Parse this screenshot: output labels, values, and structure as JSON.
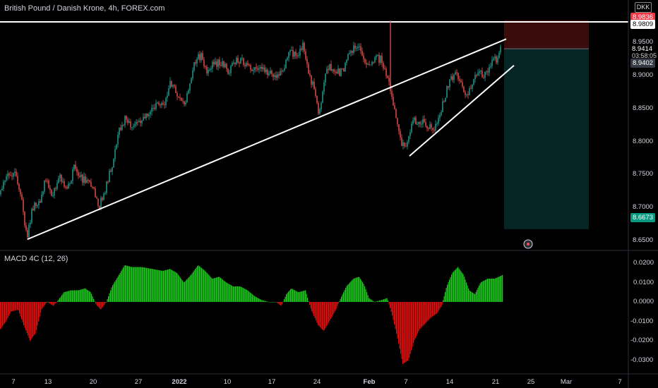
{
  "header": {
    "symbol_title": "British Pound / Danish Krone, 4h, FOREX.com",
    "currency_badge": "DKK"
  },
  "indicator": {
    "title": "MACD 4C (12, 26)"
  },
  "price_tags": {
    "stop_price": "8.9836",
    "level_price": "8.9809",
    "last_price": "8.9414",
    "countdown": "03:58:05",
    "entry_price": "8.9402",
    "target_price": "8.6673"
  },
  "colors": {
    "background": "#000000",
    "up_candle": "#26a69a",
    "down_candle": "#ef5350",
    "macd_positive": "#1ec81e",
    "macd_negative": "#e01010",
    "stop_zone": "#3a0d0d",
    "target_zone": "#062626",
    "stop_tag": "#f23645",
    "target_tag": "#089981",
    "trendline": "#ffffff"
  },
  "chart_data": [
    {
      "type": "candlestick",
      "title": "British Pound / Danish Krone, 4h, FOREX.com",
      "y_ticks": [
        "8.9500",
        "8.9000",
        "8.8500",
        "8.8000",
        "8.7500",
        "8.7000",
        "8.6500"
      ],
      "x_ticks": [
        "7",
        "13",
        "20",
        "27",
        "2022",
        "10",
        "17",
        "24",
        "Feb",
        "7",
        "14",
        "21",
        "25",
        "Mar",
        "7"
      ],
      "x_ticks_bold": [
        "2022",
        "Feb"
      ],
      "ylim": [
        8.635,
        8.985
      ],
      "price_path": [
        [
          0,
          8.72
        ],
        [
          10,
          8.75
        ],
        [
          22,
          8.75
        ],
        [
          30,
          8.72
        ],
        [
          38,
          8.652
        ],
        [
          46,
          8.7
        ],
        [
          56,
          8.705
        ],
        [
          64,
          8.74
        ],
        [
          75,
          8.72
        ],
        [
          85,
          8.748
        ],
        [
          95,
          8.725
        ],
        [
          105,
          8.76
        ],
        [
          112,
          8.745
        ],
        [
          125,
          8.74
        ],
        [
          133,
          8.73
        ],
        [
          140,
          8.7
        ],
        [
          150,
          8.73
        ],
        [
          160,
          8.77
        ],
        [
          170,
          8.82
        ],
        [
          178,
          8.835
        ],
        [
          188,
          8.82
        ],
        [
          200,
          8.83
        ],
        [
          210,
          8.845
        ],
        [
          220,
          8.855
        ],
        [
          232,
          8.855
        ],
        [
          242,
          8.89
        ],
        [
          250,
          8.875
        ],
        [
          262,
          8.855
        ],
        [
          275,
          8.92
        ],
        [
          285,
          8.93
        ],
        [
          292,
          8.905
        ],
        [
          300,
          8.915
        ],
        [
          312,
          8.92
        ],
        [
          325,
          8.905
        ],
        [
          335,
          8.925
        ],
        [
          345,
          8.92
        ],
        [
          355,
          8.91
        ],
        [
          365,
          8.91
        ],
        [
          380,
          8.905
        ],
        [
          392,
          8.9
        ],
        [
          402,
          8.91
        ],
        [
          410,
          8.935
        ],
        [
          420,
          8.93
        ],
        [
          430,
          8.945
        ],
        [
          436,
          8.905
        ],
        [
          445,
          8.88
        ],
        [
          452,
          8.84
        ],
        [
          462,
          8.915
        ],
        [
          475,
          8.905
        ],
        [
          485,
          8.905
        ],
        [
          495,
          8.935
        ],
        [
          505,
          8.945
        ],
        [
          512,
          8.935
        ],
        [
          520,
          8.91
        ],
        [
          530,
          8.925
        ],
        [
          540,
          8.925
        ],
        [
          548,
          8.9
        ],
        [
          553,
          8.88
        ],
        [
          560,
          8.84
        ],
        [
          567,
          8.8
        ],
        [
          575,
          8.79
        ],
        [
          585,
          8.83
        ],
        [
          595,
          8.83
        ],
        [
          605,
          8.825
        ],
        [
          615,
          8.82
        ],
        [
          625,
          8.85
        ],
        [
          635,
          8.885
        ],
        [
          645,
          8.905
        ],
        [
          652,
          8.89
        ],
        [
          660,
          8.865
        ],
        [
          668,
          8.885
        ],
        [
          678,
          8.905
        ],
        [
          688,
          8.9
        ],
        [
          696,
          8.92
        ],
        [
          704,
          8.925
        ],
        [
          710,
          8.941
        ]
      ],
      "spikes": [
        {
          "x": 553,
          "high": 8.983,
          "low": 8.88
        }
      ],
      "trendlines": [
        {
          "from": [
            39,
            8.652
          ],
          "to": [
            717,
            8.955
          ]
        },
        {
          "from": [
            580,
            8.778
          ],
          "to": [
            728,
            8.915
          ]
        }
      ],
      "position": {
        "type": "short",
        "entry": 8.9402,
        "stop": 8.9836,
        "target": 8.6673,
        "x_start": 714,
        "x_end": 834
      },
      "horizontal_level": 8.9809
    },
    {
      "type": "bar",
      "title": "MACD 4C (12, 26)",
      "y_ticks": [
        "0.0200",
        "0.0100",
        "0.0000",
        "-0.0100",
        "-0.0200",
        "-0.0300"
      ],
      "ylim": [
        -0.034,
        0.023
      ],
      "macd_path": [
        [
          0,
          -0.014
        ],
        [
          8,
          -0.01
        ],
        [
          15,
          -0.005
        ],
        [
          25,
          -0.004
        ],
        [
          33,
          -0.012
        ],
        [
          42,
          -0.02
        ],
        [
          50,
          -0.016
        ],
        [
          58,
          -0.004
        ],
        [
          66,
          0.0
        ],
        [
          75,
          -0.002
        ],
        [
          82,
          0.001
        ],
        [
          90,
          0.005
        ],
        [
          100,
          0.006
        ],
        [
          110,
          0.006
        ],
        [
          120,
          0.007
        ],
        [
          128,
          0.005
        ],
        [
          135,
          -0.001
        ],
        [
          142,
          -0.004
        ],
        [
          150,
          0.0
        ],
        [
          158,
          0.008
        ],
        [
          168,
          0.014
        ],
        [
          176,
          0.019
        ],
        [
          186,
          0.018
        ],
        [
          200,
          0.018
        ],
        [
          215,
          0.017
        ],
        [
          230,
          0.016
        ],
        [
          240,
          0.017
        ],
        [
          250,
          0.015
        ],
        [
          260,
          0.01
        ],
        [
          270,
          0.014
        ],
        [
          280,
          0.019
        ],
        [
          290,
          0.016
        ],
        [
          300,
          0.012
        ],
        [
          310,
          0.013
        ],
        [
          320,
          0.01
        ],
        [
          330,
          0.008
        ],
        [
          340,
          0.008
        ],
        [
          350,
          0.006
        ],
        [
          360,
          0.003
        ],
        [
          370,
          0.001
        ],
        [
          380,
          0.0
        ],
        [
          390,
          0.0
        ],
        [
          398,
          -0.002
        ],
        [
          405,
          0.004
        ],
        [
          412,
          0.007
        ],
        [
          422,
          0.005
        ],
        [
          432,
          0.006
        ],
        [
          440,
          -0.004
        ],
        [
          450,
          -0.012
        ],
        [
          458,
          -0.015
        ],
        [
          466,
          -0.01
        ],
        [
          475,
          -0.004
        ],
        [
          482,
          0.002
        ],
        [
          490,
          0.008
        ],
        [
          500,
          0.012
        ],
        [
          508,
          0.013
        ],
        [
          515,
          0.009
        ],
        [
          522,
          0.002
        ],
        [
          530,
          0.0
        ],
        [
          540,
          0.001
        ],
        [
          548,
          0.002
        ],
        [
          555,
          -0.007
        ],
        [
          562,
          -0.018
        ],
        [
          570,
          -0.032
        ],
        [
          578,
          -0.03
        ],
        [
          586,
          -0.02
        ],
        [
          594,
          -0.014
        ],
        [
          602,
          -0.011
        ],
        [
          610,
          -0.008
        ],
        [
          618,
          -0.006
        ],
        [
          625,
          -0.002
        ],
        [
          632,
          0.008
        ],
        [
          640,
          0.015
        ],
        [
          648,
          0.018
        ],
        [
          656,
          0.014
        ],
        [
          664,
          0.006
        ],
        [
          672,
          0.004
        ],
        [
          680,
          0.01
        ],
        [
          690,
          0.012
        ],
        [
          700,
          0.012
        ],
        [
          712,
          0.014
        ]
      ]
    }
  ]
}
